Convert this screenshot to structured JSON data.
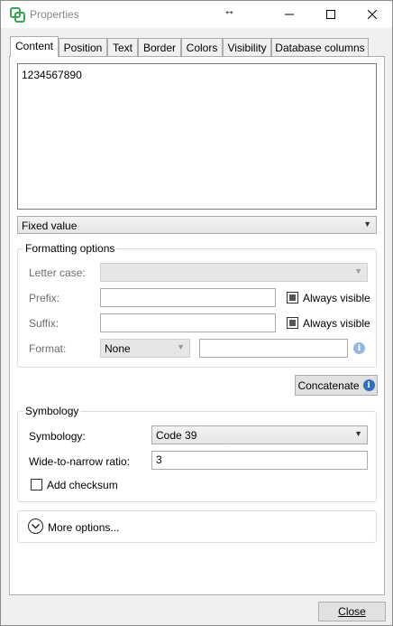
{
  "window": {
    "title": "Properties",
    "resize_glyph": "↔",
    "controls": {
      "minimize": "minimize-icon",
      "maximize": "maximize-icon",
      "close": "close-icon"
    }
  },
  "tabs": [
    {
      "label": "Content",
      "active": true
    },
    {
      "label": "Position"
    },
    {
      "label": "Text"
    },
    {
      "label": "Border"
    },
    {
      "label": "Colors"
    },
    {
      "label": "Visibility"
    },
    {
      "label": "Database columns"
    }
  ],
  "content": {
    "value": "1234567890",
    "source_select": "Fixed value"
  },
  "formatting": {
    "title": "Formatting options",
    "letter_case_label": "Letter case:",
    "letter_case_value": "",
    "prefix_label": "Prefix:",
    "prefix_value": "",
    "prefix_always_visible": "Always visible",
    "suffix_label": "Suffix:",
    "suffix_value": "",
    "suffix_always_visible": "Always visible",
    "format_label": "Format:",
    "format_value": "None",
    "format_text": ""
  },
  "concatenate_label": "Concatenate",
  "symbology": {
    "title": "Symbology",
    "symbology_label": "Symbology:",
    "symbology_value": "Code 39",
    "ratio_label": "Wide-to-narrow ratio:",
    "ratio_value": "3",
    "checksum_label": "Add checksum"
  },
  "more_options_label": "More options...",
  "close_label": "Close",
  "colors": {
    "accent": "#2f6fbf",
    "logo": "#3aa357"
  }
}
